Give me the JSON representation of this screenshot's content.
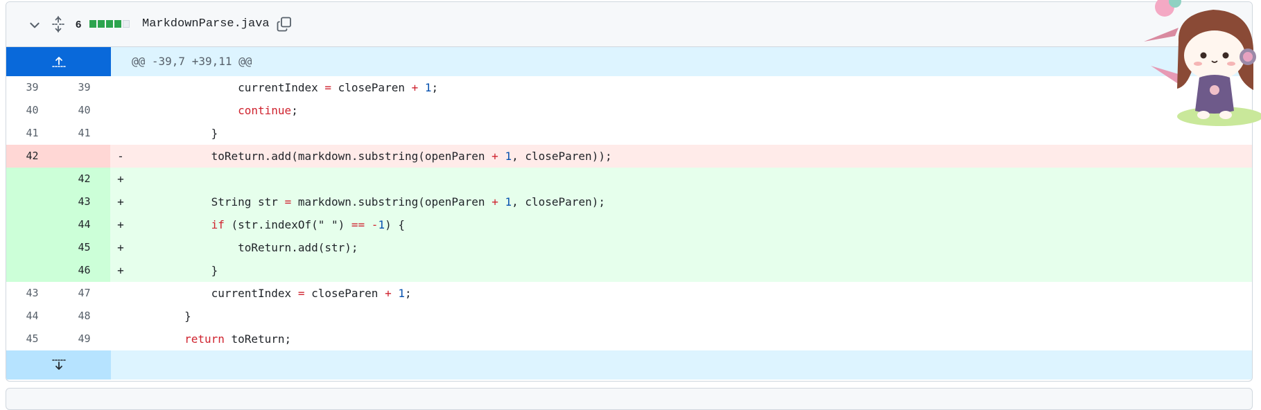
{
  "file": {
    "changes_count": "6",
    "filename": "MarkdownParse.java",
    "diffstat": [
      "add",
      "add",
      "add",
      "add",
      "neutral"
    ]
  },
  "hunk_header": "@@ -39,7 +39,11 @@",
  "lines": [
    {
      "type": "ctx",
      "old": "39",
      "new": "39",
      "sign": "",
      "code": "                currentIndex = closeParen + 1;"
    },
    {
      "type": "ctx",
      "old": "40",
      "new": "40",
      "sign": "",
      "code": "                continue;"
    },
    {
      "type": "ctx",
      "old": "41",
      "new": "41",
      "sign": "",
      "code": "            }"
    },
    {
      "type": "del",
      "old": "42",
      "new": "",
      "sign": "-",
      "code": "            toReturn.add(markdown.substring(openParen + 1, closeParen));"
    },
    {
      "type": "add",
      "old": "",
      "new": "42",
      "sign": "+",
      "code": ""
    },
    {
      "type": "add",
      "old": "",
      "new": "43",
      "sign": "+",
      "code": "            String str = markdown.substring(openParen + 1, closeParen);"
    },
    {
      "type": "add",
      "old": "",
      "new": "44",
      "sign": "+",
      "code": "            if (str.indexOf(\" \") == -1) {"
    },
    {
      "type": "add",
      "old": "",
      "new": "45",
      "sign": "+",
      "code": "                toReturn.add(str);"
    },
    {
      "type": "add",
      "old": "",
      "new": "46",
      "sign": "+",
      "code": "            }"
    },
    {
      "type": "ctx",
      "old": "43",
      "new": "47",
      "sign": "",
      "code": "            currentIndex = closeParen + 1;"
    },
    {
      "type": "ctx",
      "old": "44",
      "new": "48",
      "sign": "",
      "code": "        }"
    },
    {
      "type": "ctx",
      "old": "45",
      "new": "49",
      "sign": "",
      "code": "        return toReturn;"
    }
  ],
  "icons": {
    "collapse": "chevron-down-icon",
    "unfold": "unfold-icon",
    "copy": "copy-icon",
    "expand_up": "expand-up-icon",
    "expand_down": "expand-down-icon"
  },
  "colors": {
    "addition_bg": "#e6ffec",
    "deletion_bg": "#ffebe9",
    "hunk_bg": "#ddf4ff",
    "expander_active": "#0969da"
  }
}
